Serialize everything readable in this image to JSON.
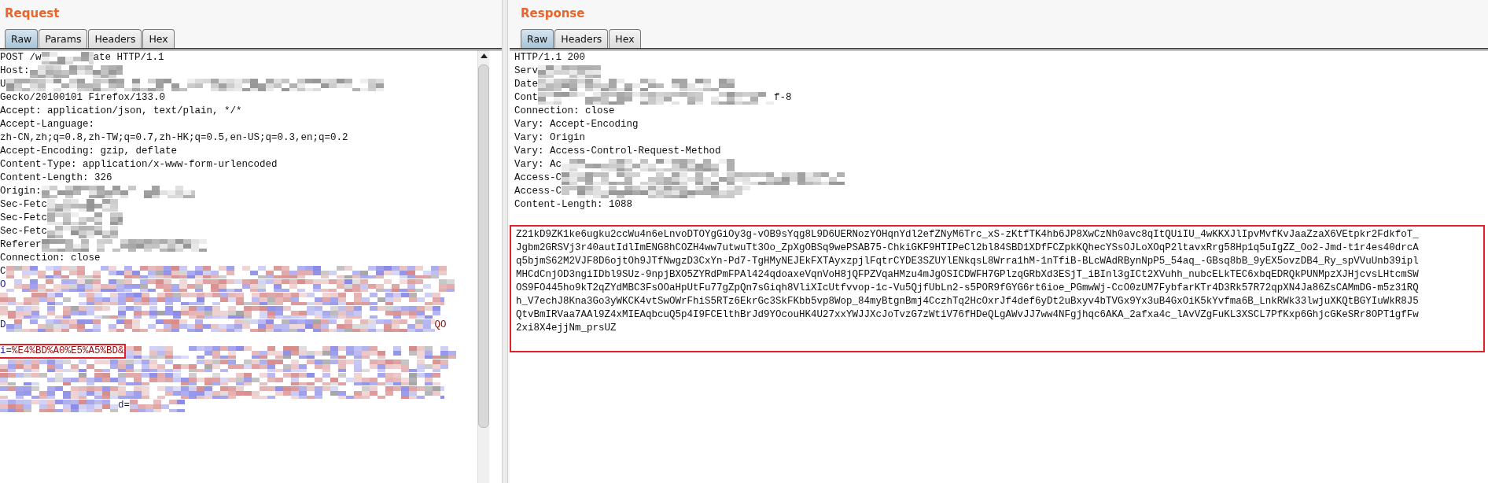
{
  "request": {
    "title": "Request",
    "tabs": [
      {
        "label": "Raw",
        "selected": true
      },
      {
        "label": "Params",
        "selected": false
      },
      {
        "label": "Headers",
        "selected": false
      },
      {
        "label": "Hex",
        "selected": false
      }
    ],
    "lines": [
      [
        {
          "kind": "plain",
          "text": "POST /w"
        },
        {
          "kind": "redacted"
        },
        {
          "kind": "plain",
          "text": "ate HTTP/1.1"
        }
      ],
      [
        {
          "kind": "plain",
          "text": "Host:"
        },
        {
          "kind": "redacted"
        }
      ],
      [
        {
          "kind": "plain",
          "text": "U"
        },
        {
          "kind": "redacted"
        }
      ],
      [
        {
          "kind": "plain",
          "text": "Gecko/20100101 Firefox/133.0"
        }
      ],
      [
        {
          "kind": "plain",
          "text": "Accept: application/json, text/plain, */*"
        }
      ],
      [
        {
          "kind": "plain",
          "text": "Accept-Language:"
        }
      ],
      [
        {
          "kind": "plain",
          "text": "zh-CN,zh;q=0.8,zh-TW;q=0.7,zh-HK;q=0.5,en-US;q=0.3,en;q=0.2"
        }
      ],
      [
        {
          "kind": "plain",
          "text": "Accept-Encoding: gzip, deflate"
        }
      ],
      [
        {
          "kind": "plain",
          "text": "Content-Type: application/x-www-form-urlencoded"
        }
      ],
      [
        {
          "kind": "plain",
          "text": "Content-Length: 326"
        }
      ],
      [
        {
          "kind": "plain",
          "text": "Origin:"
        },
        {
          "kind": "redacted"
        }
      ],
      [
        {
          "kind": "plain",
          "text": "Sec-Fetc"
        },
        {
          "kind": "redacted"
        }
      ],
      [
        {
          "kind": "plain",
          "text": "Sec-Fetc"
        },
        {
          "kind": "redacted"
        }
      ],
      [
        {
          "kind": "plain",
          "text": "Sec-Fetc"
        },
        {
          "kind": "redacted"
        }
      ],
      [
        {
          "kind": "plain",
          "text": "Referer"
        },
        {
          "kind": "redacted"
        }
      ],
      [
        {
          "kind": "plain",
          "text": "Connection: close"
        }
      ],
      [
        {
          "kind": "plain",
          "text": "C"
        },
        {
          "kind": "redacted_params"
        }
      ],
      [
        {
          "kind": "name",
          "text": "O"
        },
        {
          "kind": "redacted_params"
        }
      ],
      [
        {
          "kind": "redacted_params"
        }
      ],
      [
        {
          "kind": "redacted_params"
        }
      ],
      [
        {
          "kind": "name",
          "text": "D"
        },
        {
          "kind": "redacted_params"
        },
        {
          "kind": "value",
          "text": "QO"
        }
      ]
    ],
    "body": [
      [
        {
          "kind": "name",
          "text": "i",
          "highlighted": true
        },
        {
          "kind": "plain",
          "text": "=",
          "highlighted": true
        },
        {
          "kind": "value",
          "text": "%E4%BD%A0%E5%A5%BD&",
          "highlighted": true
        },
        {
          "kind": "redacted_params"
        }
      ],
      [
        {
          "kind": "redacted_params"
        }
      ],
      [
        {
          "kind": "redacted_params"
        }
      ],
      [
        {
          "kind": "redacted_params"
        }
      ],
      [
        {
          "kind": "redacted_params"
        },
        {
          "kind": "name",
          "text": "d"
        },
        {
          "kind": "plain",
          "text": "="
        },
        {
          "kind": "redacted_params"
        }
      ]
    ]
  },
  "response": {
    "title": "Response",
    "tabs": [
      {
        "label": "Raw",
        "selected": true
      },
      {
        "label": "Headers",
        "selected": false
      },
      {
        "label": "Hex",
        "selected": false
      }
    ],
    "lines": [
      [
        {
          "kind": "plain",
          "text": "HTTP/1.1 200"
        }
      ],
      [
        {
          "kind": "plain",
          "text": "Serv"
        },
        {
          "kind": "redacted"
        }
      ],
      [
        {
          "kind": "plain",
          "text": "Date"
        },
        {
          "kind": "redacted"
        }
      ],
      [
        {
          "kind": "plain",
          "text": "Cont"
        },
        {
          "kind": "redacted"
        },
        {
          "kind": "plain",
          "text": "f-8"
        }
      ],
      [
        {
          "kind": "plain",
          "text": "Connection: close"
        }
      ],
      [
        {
          "kind": "plain",
          "text": "Vary: Accept-Encoding"
        }
      ],
      [
        {
          "kind": "plain",
          "text": "Vary: Origin"
        }
      ],
      [
        {
          "kind": "plain",
          "text": "Vary: Access-Control-Request-Method"
        }
      ],
      [
        {
          "kind": "plain",
          "text": "Vary: Ac"
        },
        {
          "kind": "redacted"
        }
      ],
      [
        {
          "kind": "plain",
          "text": "Access-C"
        },
        {
          "kind": "redacted"
        }
      ],
      [
        {
          "kind": "plain",
          "text": "Access-C"
        },
        {
          "kind": "redacted"
        }
      ],
      [
        {
          "kind": "plain",
          "text": "Content-Length: 1088"
        }
      ]
    ],
    "body": {
      "highlighted": true,
      "lines": [
        "Z21kD9ZK1ke6ugku2ccWu4n6eLnvoDTOYgGiOy3g-vOB9sYqg8L9D6UERNozYOHqnYdl2efZNyM6Trc_xS-zKtfTK4hb6JP8XwCzNh0avc8qItQUiIU_4wKKXJlIpvMvfKvJaaZzaX6VEtpkr2FdkfoT_",
        "Jgbm2GRSVj3r40autIdlImENG8hCOZH4ww7utwuTt3Oo_ZpXgOBSq9wePSAB75-ChkiGKF9HTIPeCl2bl84SBD1XDfFCZpkKQhecYSsOJLoXOqP2ltavxRrg58Hp1q5uIgZZ_Oo2-Jmd-t1r4es40drcA",
        "q5bjmS62M2VJF8D6ojtOh9JTfNwgzD3CxYn-Pd7-TgHMyNEJEkFXTAyxzpjlFqtrCYDE3SZUYlENkqsL8Wrra1hM-1nTfiB-BLcWAdRBynNpP5_54aq_-GBsq8bB_9yEX5ovzDB4_Ry_spVVuUnb39ipl",
        "MHCdCnjOD3ngiIDbl9SUz-9npjBXO5ZYRdPmFPAl424qdoaxeVqnVoH8jQFPZVqaHMzu4mJgOSICDWFH7GPlzqGRbXd3ESjT_iBInl3gICt2XVuhh_nubcELkTEC6xbqEDRQkPUNMpzXJHjcvsLHtcmSW",
        "OS9FO445ho9kT2qZYdMBC3FsOOaHpUtFu77gZpQn7sGiqh8VliXIcUtfvvop-1c-Vu5QjfUbLn2-s5POR9fGYG6rt6ioe_PGmwWj-CcO0zUM7FybfarKTr4D3Rk57R72qpXN4Ja86ZsCAMmDG-m5z31RQ",
        "h_V7echJ8Kna3Go3yWKCK4vtSwOWrFhiS5RTz6EkrGc3SkFKbb5vp8Wop_84myBtgnBmj4CczhTq2HcOxrJf4def6yDt2uBxyv4bTVGx9Yx3uB4GxOiK5kYvfma6B_LnkRWk33lwjuXKQtBGYIuWkR8J5",
        "QtvBmIRVaa7AAl9Z4xMIEAqbcuQ5p4I9FCElthBrJd9YOcouHK4U27xxYWJJXcJoTvzG7zWtiV76fHDeQLgAWvJJ7ww4NFgjhqc6AKA_2afxa4c_lAvVZgFuKL3XSCL7PfKxp6GhjcGKeSRr8OPT1gfFw",
        "2xi8X4ejjNm_prsUZ"
      ]
    }
  }
}
